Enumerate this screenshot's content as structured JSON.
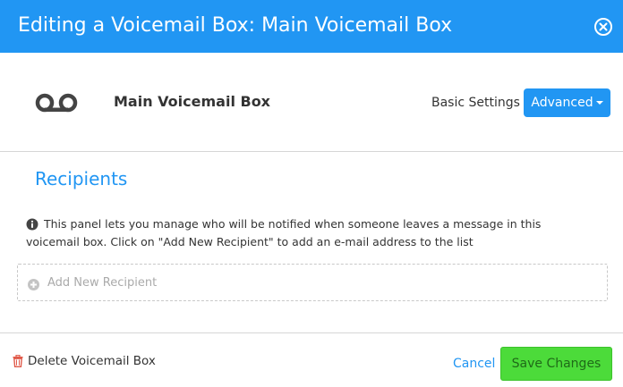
{
  "header": {
    "title": "Editing a Voicemail Box: Main Voicemail Box",
    "close_icon": "close-circle-icon"
  },
  "box": {
    "icon": "voicemail-icon",
    "name": "Main Voicemail Box",
    "basic_settings_label": "Basic Settings",
    "advanced_label": "Advanced"
  },
  "recipients": {
    "heading": "Recipients",
    "info_text": "This panel lets you manage who will be notified when someone leaves a message in this voicemail box. Click on \"Add New Recipient\" to add an e-mail address to the list",
    "add_label": "Add New Recipient"
  },
  "footer": {
    "delete_label": "Delete Voicemail Box",
    "cancel_label": "Cancel",
    "save_label": "Save Changes"
  },
  "colors": {
    "accent": "#2196f3",
    "save": "#4cdb3a",
    "delete_icon": "#e05a4a"
  }
}
